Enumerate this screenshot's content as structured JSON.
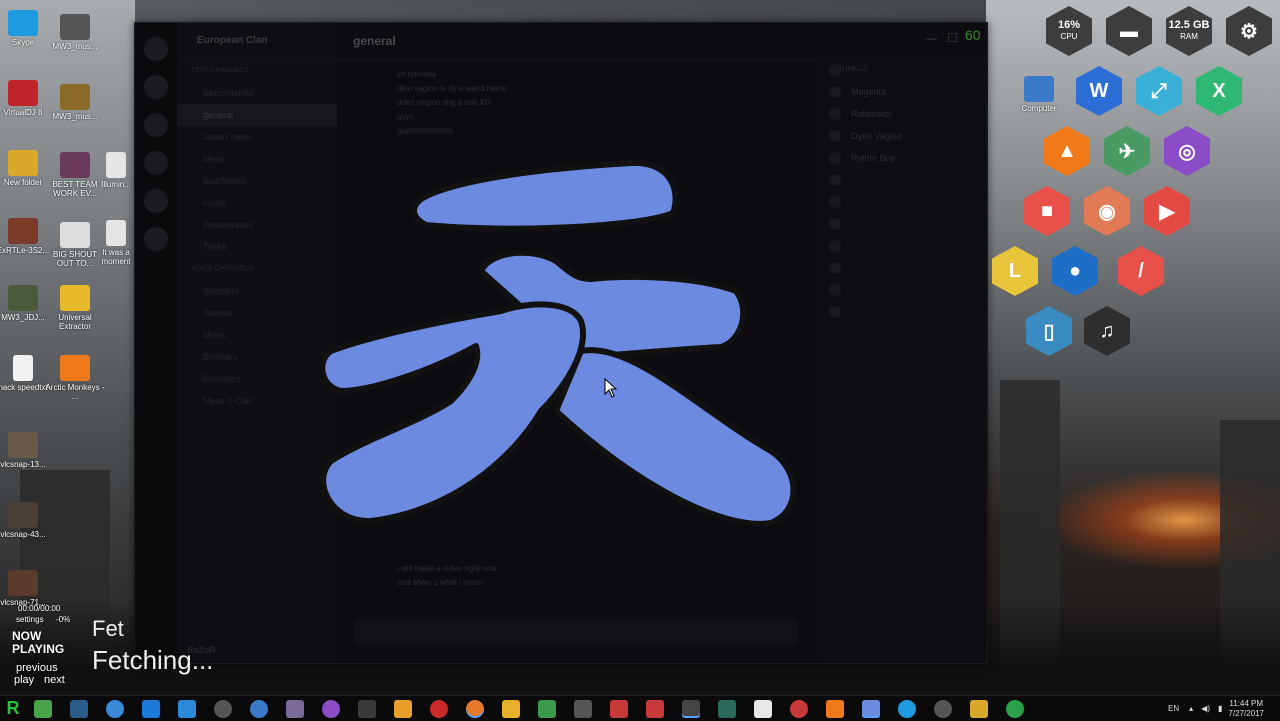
{
  "desktop": {
    "icons": [
      {
        "label": "Skype"
      },
      {
        "label": "MW3_mus..."
      },
      {
        "label": "VirtualDJ 8"
      },
      {
        "label": "MW3_mus..."
      },
      {
        "label": "New folder"
      },
      {
        "label": "BEST TEAM WORK EV..."
      },
      {
        "label": "Illumin..."
      },
      {
        "label": "ExRTLe-3S2..."
      },
      {
        "label": "BIG SHOUT OUT TO..."
      },
      {
        "label": "It was a moment"
      },
      {
        "label": "MW3_JDJ..."
      },
      {
        "label": "Universal Extractor"
      },
      {
        "label": "hack speedtxt"
      },
      {
        "label": "Arctic Monkeys - ..."
      },
      {
        "label": "vlcsnap-13..."
      },
      {
        "label": "vlcsnap-43..."
      },
      {
        "label": "vlcsnap-71..."
      },
      {
        "label": "Computer"
      }
    ]
  },
  "discord": {
    "server_name": "European Clan",
    "channel_title": "general",
    "channels_text_header": "TEXT CHANNELS",
    "channels": [
      "welcomeinfo",
      "general",
      "admin-room",
      "ideas",
      "toxicfreaks",
      "music",
      "Presentation",
      "Tricks"
    ],
    "channels_voice_header": "VOICE CHANNELS",
    "voice_channels": [
      "Shooters",
      "Admins",
      "Music",
      "Brothers",
      "Founders",
      "Mese-s-Clan"
    ],
    "messages": [
      "im homeee",
      "dino vagino is rly a weird name",
      "does vagino ring a bell XD",
      "guys",
      "guysssssssssss",
      "i will make a video right now",
      "and show u what i mean"
    ],
    "members_header_online": "ONLINE—2",
    "members": [
      "Magenta",
      "Raktinator",
      "Dyno Vagino",
      "Rythm Boy"
    ],
    "user_name": "RaZoR",
    "logo_glyph": "天",
    "logo_color": "#6b8ae0",
    "badge": "60"
  },
  "widgets": {
    "cpu_value": "16%",
    "cpu_label": "CPU",
    "ram_value": "12.5 GB",
    "ram_label": "RAM"
  },
  "media": {
    "time": "00:00/00:00",
    "settings": "settings",
    "volume": "-0%",
    "now_playing": "NOW PLAYING",
    "previous": "previous",
    "play": "play",
    "next": "next",
    "fetch_line1": "Fet",
    "fetch_line2": "Fetching..."
  },
  "taskbar": {
    "lang": "EN",
    "time": "11:44 PM",
    "date": "7/27/2017"
  },
  "colors": {
    "cpu_hex": "#3d3d3d",
    "w_hex": "#2b6fd6",
    "share_hex": "#3ab0d8",
    "x_hex": "#2fb874",
    "vlc_hex": "#f07a1a",
    "kite_hex": "#4a9a63",
    "circle_hex": "#8a4cc7",
    "red_hex": "#e8504a",
    "orange_hex": "#e07b55",
    "youtube_hex": "#e34a44",
    "l_hex": "#e8c53a",
    "drop_hex": "#1c6ec7",
    "dash_hex": "#e8504a",
    "game_hex": "#3a8bc2",
    "music_hex": "#2e2e2e"
  }
}
